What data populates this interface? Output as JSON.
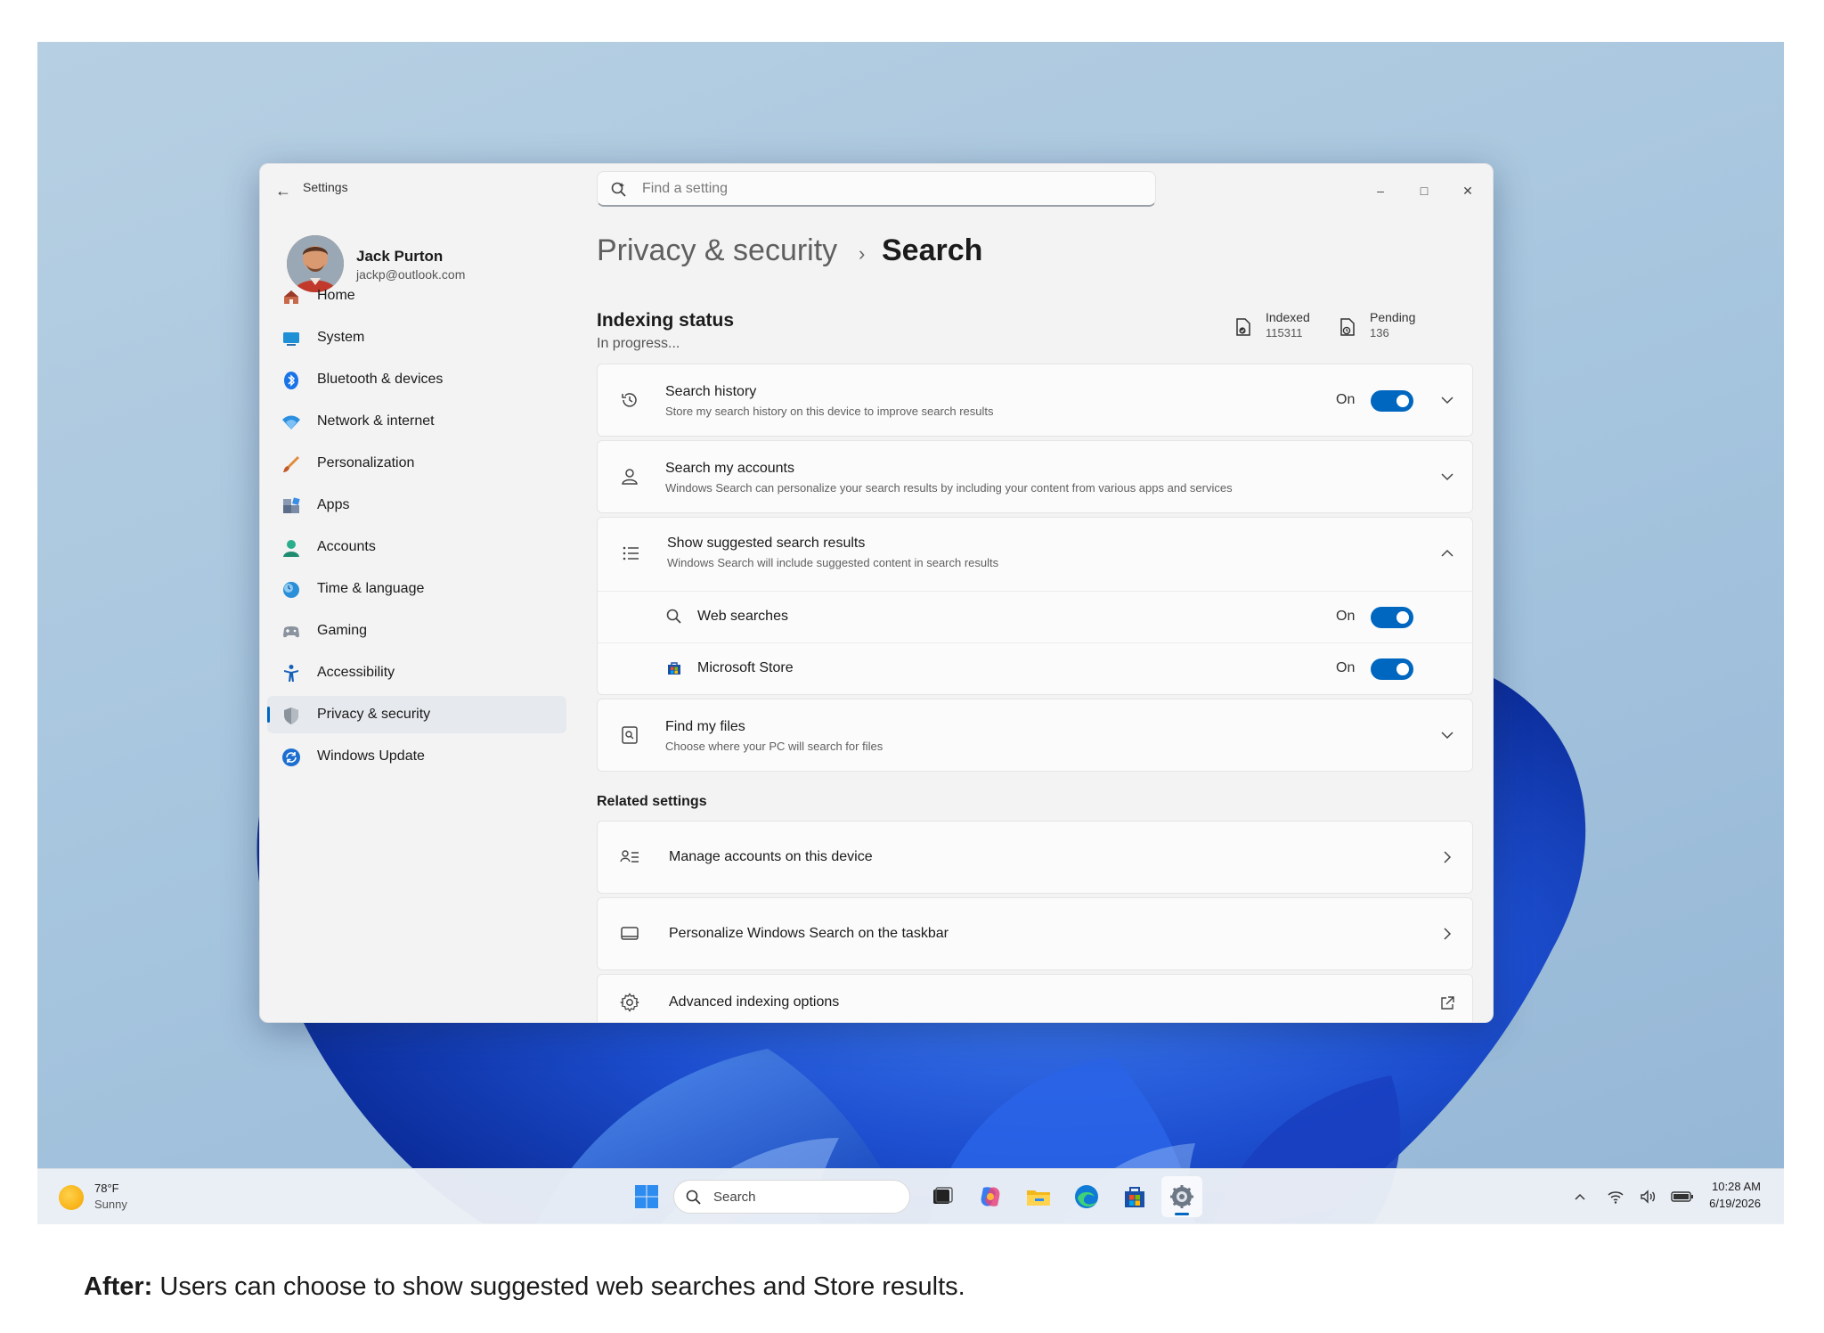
{
  "window": {
    "app_title": "Settings",
    "search_placeholder": "Find a setting",
    "minimize": "–",
    "maximize": "□",
    "close": "✕"
  },
  "profile": {
    "name": "Jack Purton",
    "email": "jackp@outlook.com"
  },
  "nav": [
    {
      "label": "Home",
      "icon": "home-icon",
      "color": "#c0504d"
    },
    {
      "label": "System",
      "icon": "system-icon",
      "color": "#1f8fd6"
    },
    {
      "label": "Bluetooth & devices",
      "icon": "bluetooth-icon",
      "color": "#1a73e8"
    },
    {
      "label": "Network & internet",
      "icon": "wifi-icon",
      "color": "#2b8fe0"
    },
    {
      "label": "Personalization",
      "icon": "brush-icon",
      "color": "#e07a2e"
    },
    {
      "label": "Apps",
      "icon": "apps-icon",
      "color": "#5a6d8a"
    },
    {
      "label": "Accounts",
      "icon": "accounts-icon",
      "color": "#2bae8c"
    },
    {
      "label": "Time & language",
      "icon": "globe-clock-icon",
      "color": "#2a8fd8"
    },
    {
      "label": "Gaming",
      "icon": "gamepad-icon",
      "color": "#7d8794"
    },
    {
      "label": "Accessibility",
      "icon": "accessibility-icon",
      "color": "#1660b8"
    },
    {
      "label": "Privacy & security",
      "icon": "shield-icon",
      "color": "#7d8590",
      "selected": true
    },
    {
      "label": "Windows Update",
      "icon": "update-icon",
      "color": "#1c6fd0"
    }
  ],
  "breadcrumb": {
    "parent": "Privacy & security",
    "separator": "›",
    "current": "Search"
  },
  "indexing": {
    "title": "Indexing status",
    "status": "In progress...",
    "indexed_label": "Indexed",
    "indexed_value": "115311",
    "pending_label": "Pending",
    "pending_value": "136"
  },
  "cards": {
    "search_history": {
      "title": "Search history",
      "desc": "Store my search history on this device to improve search results",
      "state": "On"
    },
    "search_accounts": {
      "title": "Search my accounts",
      "desc": "Windows Search can personalize your search results by including your content from various apps and services"
    },
    "suggested": {
      "title": "Show suggested search results",
      "desc": "Windows Search will include suggested content in search results",
      "web": {
        "label": "Web searches",
        "state": "On"
      },
      "store": {
        "label": "Microsoft Store",
        "state": "On"
      }
    },
    "find_files": {
      "title": "Find my files",
      "desc": "Choose where your PC will search for files"
    }
  },
  "related": {
    "title": "Related settings",
    "items": [
      "Manage accounts on this device",
      "Personalize Windows Search on the taskbar",
      "Advanced indexing options"
    ]
  },
  "taskbar": {
    "temp": "78°F",
    "condition": "Sunny",
    "search": "Search",
    "time": "10:28 AM",
    "date": "6/19/2026"
  },
  "caption": {
    "lead": "After:",
    "text": " Users can choose to show suggested web searches and Store results."
  },
  "colors": {
    "accent": "#0067c0",
    "window_bg": "#f3f3f3",
    "card_bg": "#fbfbfb"
  }
}
